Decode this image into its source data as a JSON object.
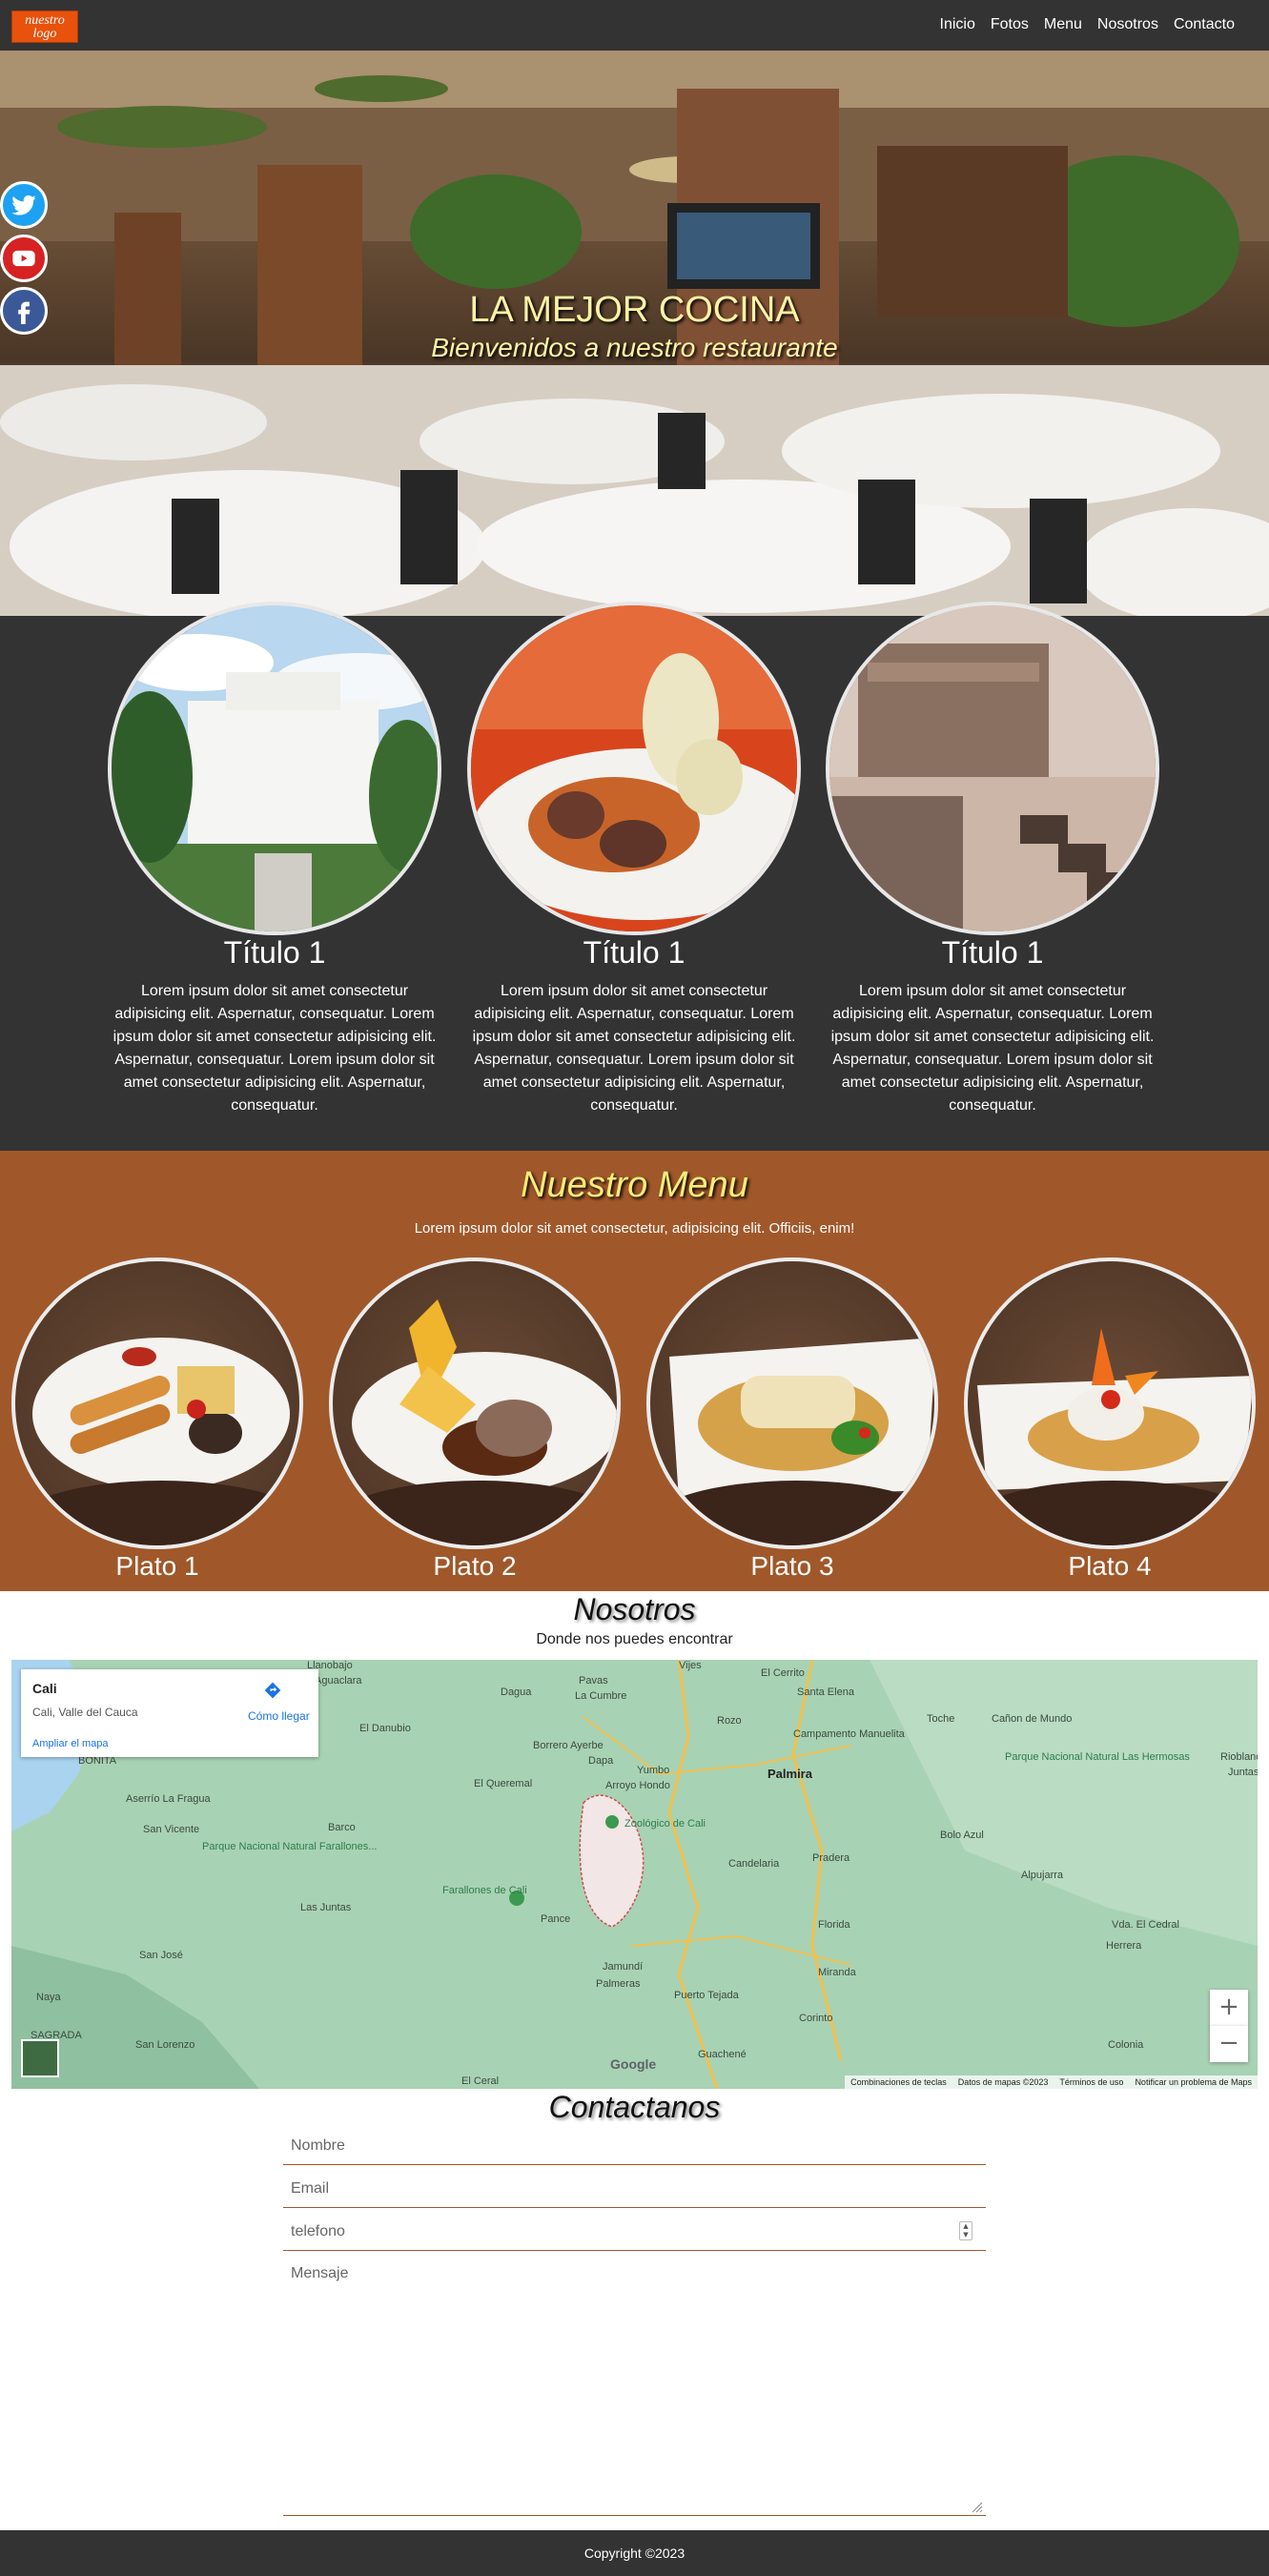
{
  "nav": {
    "logo_text": "nuestro logo",
    "links": [
      "Inicio",
      "Fotos",
      "Menu",
      "Nosotros",
      "Contacto"
    ]
  },
  "hero": {
    "title": "LA MEJOR COCINA",
    "subtitle": "Bienvenidos a nuestro restaurante"
  },
  "social": [
    "twitter-icon",
    "youtube-icon",
    "facebook-icon"
  ],
  "features": [
    {
      "title": "Título 1",
      "text": "Lorem ipsum dolor sit amet consectetur adipisicing elit. Aspernatur, consequatur. Lorem ipsum dolor sit amet consectetur adipisicing elit. Aspernatur, consequatur. Lorem ipsum dolor sit amet consectetur adipisicing elit. Aspernatur, consequatur."
    },
    {
      "title": "Título 1",
      "text": "Lorem ipsum dolor sit amet consectetur adipisicing elit. Aspernatur, consequatur. Lorem ipsum dolor sit amet consectetur adipisicing elit. Aspernatur, consequatur. Lorem ipsum dolor sit amet consectetur adipisicing elit. Aspernatur, consequatur."
    },
    {
      "title": "Título 1",
      "text": "Lorem ipsum dolor sit amet consectetur adipisicing elit. Aspernatur, consequatur. Lorem ipsum dolor sit amet consectetur adipisicing elit. Aspernatur, consequatur. Lorem ipsum dolor sit amet consectetur adipisicing elit. Aspernatur, consequatur."
    }
  ],
  "menu": {
    "title": "Nuestro Menu",
    "subtitle": "Lorem ipsum dolor sit amet consectetur, adipisicing elit. Officiis, enim!",
    "plates": [
      "Plato 1",
      "Plato 2",
      "Plato 3",
      "Plato 4"
    ]
  },
  "nosotros": {
    "title": "Nosotros",
    "subtitle": "Donde nos puedes encontrar",
    "map": {
      "place": "Cali",
      "address": "Cali, Valle del Cauca",
      "directions": "Cómo llegar",
      "enlarge": "Ampliar el mapa",
      "labels": [
        "Llanobajo",
        "Aguaclara",
        "Vijes",
        "El Cerrito",
        "Pavas",
        "La Cumbre",
        "Dagua",
        "Santa Elena",
        "Rozo",
        "Toche",
        "Cañon de Mundo",
        "El Danubio",
        "Borrero Ayerbe",
        "Dapa",
        "Yumbo",
        "Arroyo Hondo",
        "Campamento Manuelita",
        "Palmira",
        "El Queremal",
        "Parque Nacional Natural Las Hermosas",
        "BONITA",
        "Aserrío La Fragua",
        "San Vicente",
        "Barco",
        "Zoológico de Cali",
        "Bolo Azul",
        "Parque Nacional Natural Farallones...",
        "Candelaria",
        "Pradera",
        "Alpujarra",
        "Las Juntas",
        "Farallones de Cali",
        "Pance",
        "Florida",
        "Vda. El Cedral",
        "Herrera",
        "San José",
        "Jamundí",
        "Palmeras",
        "Miranda",
        "Naya",
        "Puerto Tejada",
        "Corinto",
        "San Lorenzo",
        "Guachené",
        "Colonia",
        "SAGRADA",
        "El Ceral",
        "Rioblanco",
        "Juntas"
      ],
      "google": "Google",
      "footer": [
        "Combinaciones de teclas",
        "Datos de mapas ©2023",
        "Términos de uso",
        "Notificar un problema de Maps"
      ]
    }
  },
  "contact": {
    "title": "Contactanos",
    "name_placeholder": "Nombre",
    "email_placeholder": "Email",
    "phone_placeholder": "telefono",
    "message_placeholder": "Mensaje"
  },
  "footer": {
    "copyright": "Copyright ©2023"
  },
  "colors": {
    "dark": "#333333",
    "menu_bg": "#a0582a",
    "accent_yellow": "#f7ec7a",
    "logo_orange": "#e8520d"
  }
}
